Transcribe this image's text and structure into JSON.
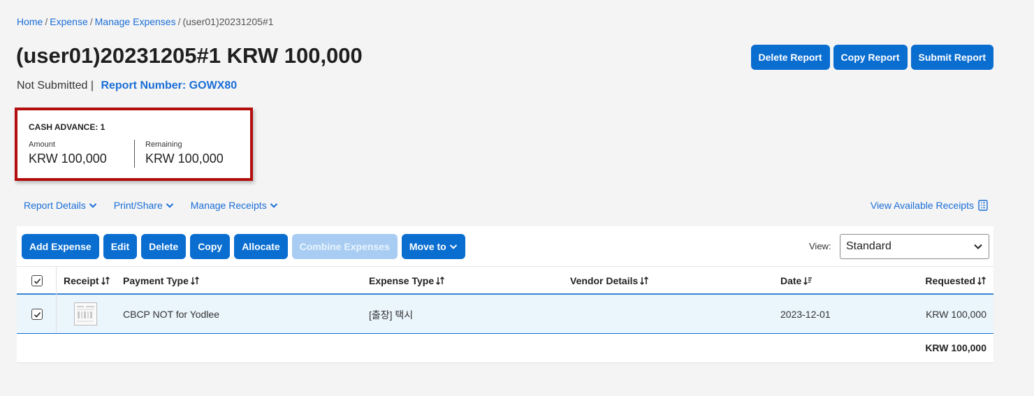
{
  "breadcrumb": {
    "home": "Home",
    "expense": "Expense",
    "manage_expenses": "Manage Expenses",
    "current": "(user01)20231205#1",
    "separator": "/"
  },
  "report": {
    "title": "(user01)20231205#1 KRW 100,000",
    "status": "Not Submitted",
    "status_separator": "|",
    "report_number": "Report Number: GOWX80"
  },
  "top_actions": {
    "delete_report": "Delete Report",
    "copy_report": "Copy Report",
    "submit_report": "Submit Report"
  },
  "cash_advance": {
    "title": "CASH ADVANCE: 1",
    "amount_label": "Amount",
    "amount_value": "KRW 100,000",
    "remaining_label": "Remaining",
    "remaining_value": "KRW 100,000"
  },
  "tabs": {
    "report_details": "Report Details",
    "print_share": "Print/Share",
    "manage_receipts": "Manage Receipts",
    "view_available_receipts": "View Available Receipts"
  },
  "toolbar": {
    "add_expense": "Add Expense",
    "edit": "Edit",
    "delete": "Delete",
    "copy": "Copy",
    "allocate": "Allocate",
    "combine_expenses": "Combine Expenses",
    "move_to": "Move to",
    "view_label": "View:",
    "view_selected": "Standard"
  },
  "table": {
    "columns": {
      "receipt": "Receipt",
      "payment_type": "Payment Type",
      "expense_type": "Expense Type",
      "vendor_details": "Vendor Details",
      "date": "Date",
      "requested": "Requested"
    },
    "rows": [
      {
        "payment_type": "CBCP NOT for Yodlee",
        "expense_type": "[출장] 택시",
        "vendor_details": "",
        "date": "2023-12-01",
        "requested": "KRW 100,000"
      }
    ],
    "total": "KRW 100,000"
  },
  "colors": {
    "primary": "#0a6ed1",
    "link": "#1a6ed8",
    "highlight_border": "#b30d0d",
    "selected_row": "#eaf5fc"
  },
  "icons": {
    "chevron": "chevron-down-icon",
    "receipts": "receipt-list-icon",
    "sort": "sort-arrows-icon",
    "sort_desc": "sort-descending-icon",
    "checkbox": "checkbox-checked-icon"
  }
}
